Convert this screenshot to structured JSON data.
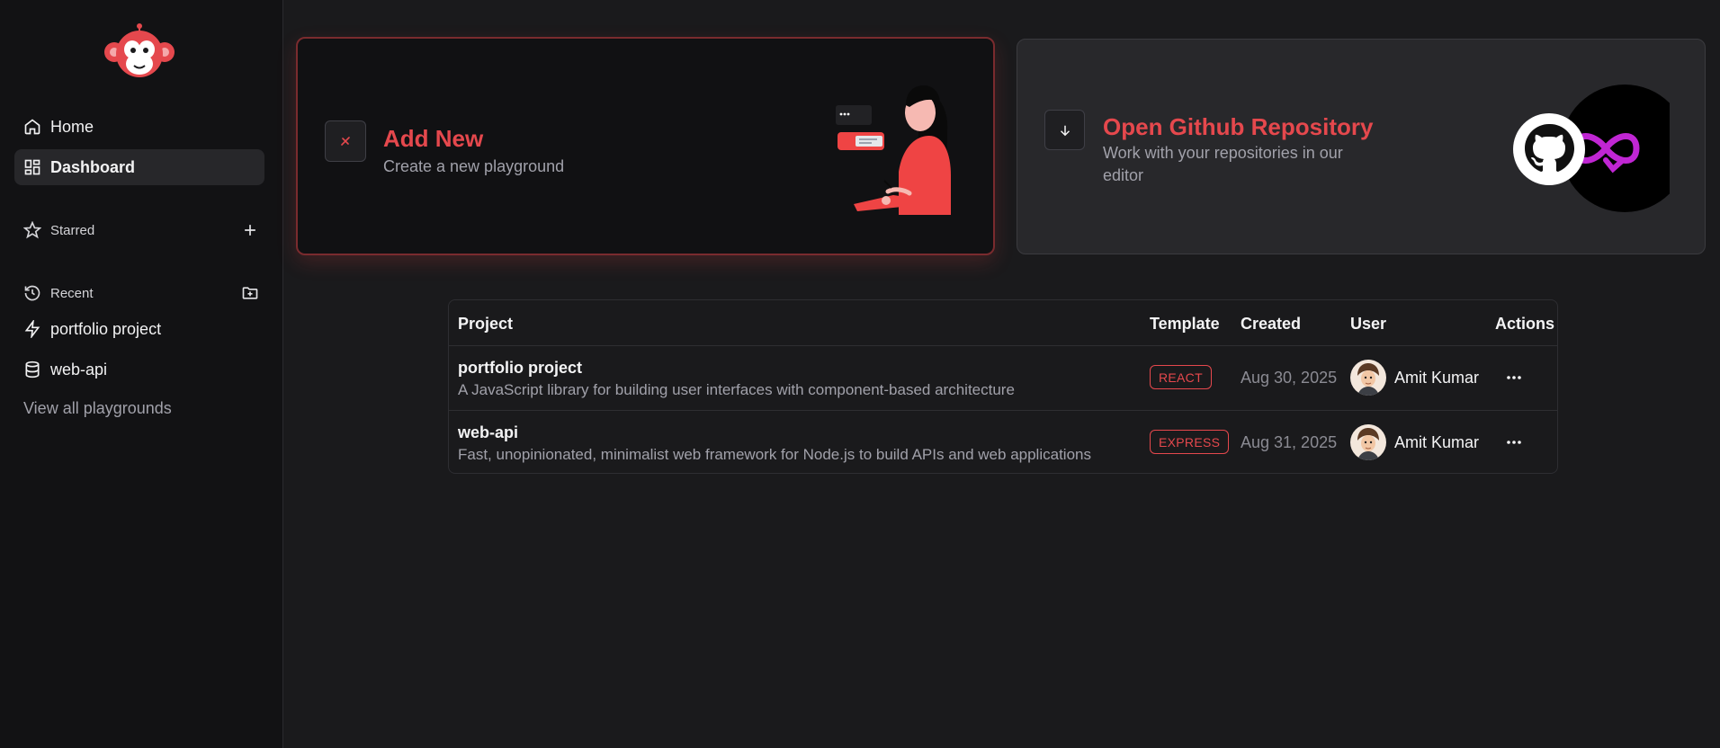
{
  "sidebar": {
    "nav": [
      {
        "label": "Home",
        "icon": "home-icon"
      },
      {
        "label": "Dashboard",
        "icon": "dashboard-icon",
        "active": true
      }
    ],
    "starred": {
      "label": "Starred",
      "icon": "star-icon",
      "action_icon": "plus-icon"
    },
    "recent": {
      "label": "Recent",
      "icon": "history-icon",
      "action_icon": "folder-plus-icon",
      "items": [
        {
          "label": "portfolio project",
          "icon": "zap-icon"
        },
        {
          "label": "web-api",
          "icon": "database-icon"
        }
      ],
      "view_all": "View all playgrounds"
    }
  },
  "cards": {
    "add": {
      "title": "Add New",
      "subtitle": "Create a new playground",
      "icon": "add-icon"
    },
    "github": {
      "title": "Open Github Repository",
      "subtitle_line1": "Work with your repositories in our",
      "subtitle_line2": "editor",
      "icon": "arrow-down-icon"
    }
  },
  "table": {
    "headers": [
      "Project",
      "Template",
      "Created",
      "User",
      "Actions"
    ],
    "rows": [
      {
        "name": "portfolio project",
        "description": "A JavaScript library for building user interfaces with component-based architecture",
        "template": "REACT",
        "created": "Aug 30, 2025",
        "user": "Amit Kumar"
      },
      {
        "name": "web-api",
        "description": "Fast, unopinionated, minimalist web framework for Node.js to build APIs and web applications",
        "template": "EXPRESS",
        "created": "Aug 31, 2025",
        "user": "Amit Kumar"
      }
    ]
  },
  "colors": {
    "accent": "#e5484d",
    "background": "#1a1a1c",
    "sidebar": "#121214"
  }
}
